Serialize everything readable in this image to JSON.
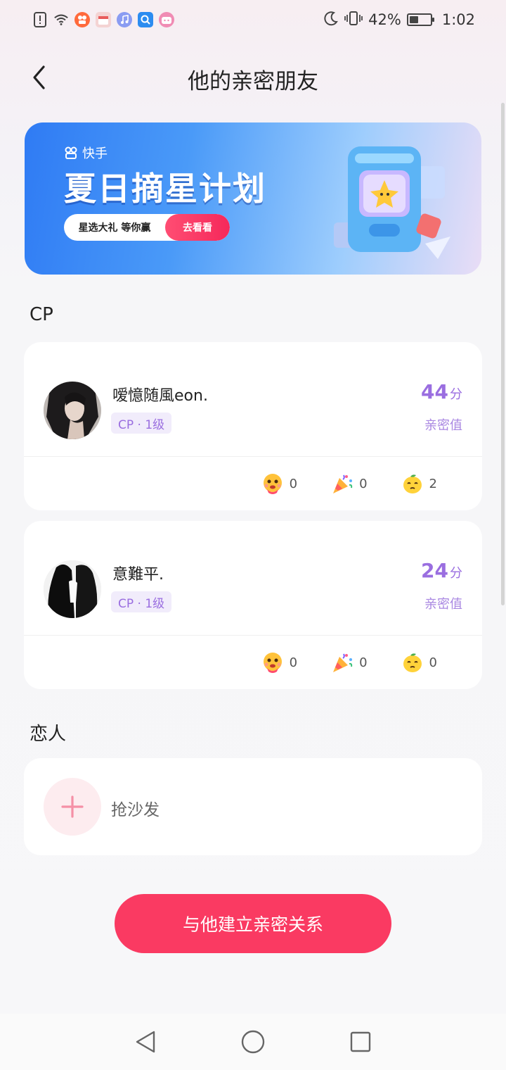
{
  "status_bar": {
    "battery_text": "42%",
    "battery_level": 0.42,
    "time": "1:02",
    "icons": [
      "alert-icon",
      "wifi-icon",
      "kuaishou-icon",
      "calendar-icon",
      "music-icon",
      "search-app-icon",
      "bilibili-icon",
      "moon-icon",
      "vibrate-icon",
      "battery-icon"
    ]
  },
  "header": {
    "title": "他的亲密朋友",
    "back_icon": "chevron-left-icon"
  },
  "banner": {
    "logo_text": "快手",
    "title": "夏日摘星计划",
    "pill_text": "星选大礼 等你赢",
    "button_label": "去看看"
  },
  "cp_section": {
    "label": "CP",
    "friends": [
      {
        "name": "嗳憶随風eon.",
        "badge": "CP · 1级",
        "score": "44",
        "score_unit": "分",
        "score_label": "亲密值",
        "reactions": [
          {
            "icon": "hug-emoji-icon",
            "count": "0"
          },
          {
            "icon": "party-popper-icon",
            "count": "0"
          },
          {
            "icon": "lemon-emoji-icon",
            "count": "2"
          }
        ]
      },
      {
        "name": "意難平.",
        "badge": "CP · 1级",
        "score": "24",
        "score_unit": "分",
        "score_label": "亲密值",
        "reactions": [
          {
            "icon": "hug-emoji-icon",
            "count": "0"
          },
          {
            "icon": "party-popper-icon",
            "count": "0"
          },
          {
            "icon": "lemon-emoji-icon",
            "count": "0"
          }
        ]
      }
    ]
  },
  "lover_section": {
    "label": "恋人",
    "empty_text": "抢沙发"
  },
  "cta": {
    "label": "与他建立亲密关系"
  },
  "colors": {
    "accent_pink": "#fa3a62",
    "cp_purple": "#9a6ee0",
    "badge_bg": "#f1ecfb"
  },
  "nav": [
    "back-nav-icon",
    "home-nav-icon",
    "recents-nav-icon"
  ]
}
